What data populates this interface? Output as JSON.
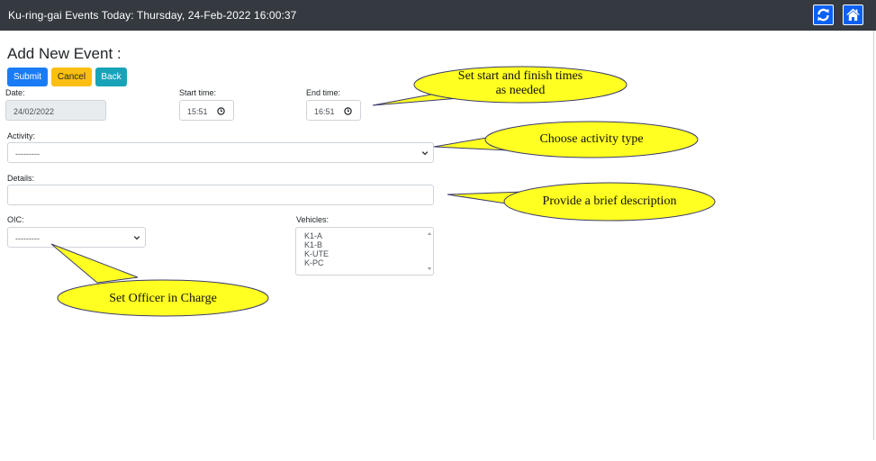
{
  "header": {
    "title": "Ku-ring-gai Events Today: Thursday, 24-Feb-2022 16:00:37",
    "refresh_icon": "refresh-icon",
    "home_icon": "home-icon",
    "icon_color": "#0b60f4"
  },
  "form": {
    "heading": "Add New Event :",
    "buttons": {
      "submit": "Submit",
      "cancel": "Cancel",
      "back": "Back"
    },
    "date": {
      "label": "Date:",
      "value": "24/02/2022"
    },
    "start_time": {
      "label": "Start time:",
      "value": "15:51"
    },
    "end_time": {
      "label": "End time:",
      "value": "16:51"
    },
    "activity": {
      "label": "Activity:",
      "value": "---------"
    },
    "details": {
      "label": "Details:",
      "value": ""
    },
    "oic": {
      "label": "OIC:",
      "value": "---------"
    },
    "vehicles": {
      "label": "Vehicles:",
      "options": [
        "K1-A",
        "K1-B",
        "K-UTE",
        "K-PC"
      ]
    }
  },
  "callouts": {
    "times": [
      "Set start and finish times",
      "as needed"
    ],
    "activity": "Choose activity type",
    "details": "Provide a brief description",
    "oic": "Set Officer in Charge",
    "fill_color": "#ffff22"
  },
  "colors": {
    "header_bg": "#343a40",
    "submit": "#1a7cf4",
    "cancel": "#fbbf13",
    "back": "#18a3b8"
  }
}
